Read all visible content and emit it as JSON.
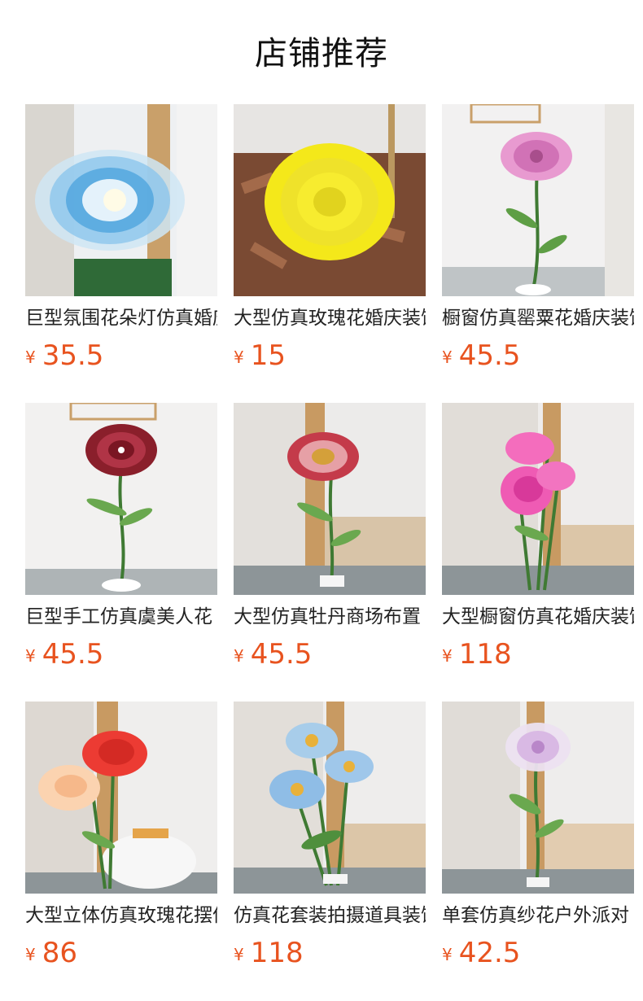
{
  "header": {
    "title": "店铺推荐"
  },
  "currency": "¥",
  "products": [
    {
      "title": "巨型氛围花朵灯仿真婚庆",
      "price": "35.5",
      "image": "blue-peony-flower-lamp"
    },
    {
      "title": "大型仿真玫瑰花婚庆装饰",
      "price": "15",
      "image": "yellow-foam-rose"
    },
    {
      "title": "橱窗仿真罂粟花婚庆装饰",
      "price": "45.5",
      "image": "pink-poppy-flower"
    },
    {
      "title": "巨型手工仿真虞美人花",
      "price": "45.5",
      "image": "red-plaid-rose"
    },
    {
      "title": "大型仿真牡丹商场布置",
      "price": "45.5",
      "image": "red-gingham-peony"
    },
    {
      "title": "大型橱窗仿真花婚庆装饰",
      "price": "118",
      "image": "pink-rose-trio"
    },
    {
      "title": "大型立体仿真玫瑰花摆件",
      "price": "86",
      "image": "red-and-peach-roses"
    },
    {
      "title": "仿真花套装拍摄道具装饰",
      "price": "118",
      "image": "blue-flower-trio"
    },
    {
      "title": "单套仿真纱花户外派对",
      "price": "42.5",
      "image": "lilac-tulle-flower"
    }
  ]
}
